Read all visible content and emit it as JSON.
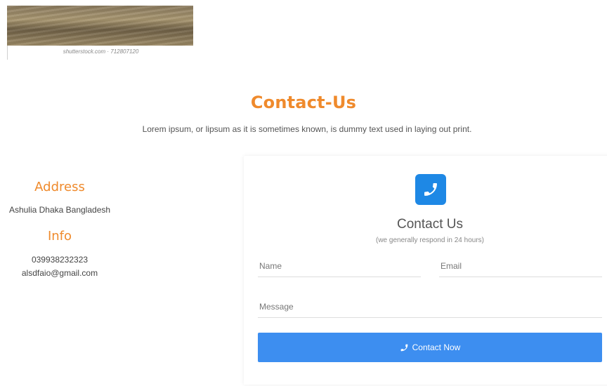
{
  "hero": {
    "caption": "shutterstock.com · 712807120"
  },
  "header": {
    "title": "Contact-Us",
    "subtitle": "Lorem ipsum, or lipsum as it is sometimes known, is dummy text used in laying out print."
  },
  "sidebar": {
    "address_heading": "Address",
    "address_text": "Ashulia Dhaka Bangladesh",
    "info_heading": "Info",
    "phone": "039938232323",
    "email": "alsdfaio@gmail.com"
  },
  "form": {
    "title": "Contact Us",
    "subtitle": "(we generally respond in 24 hours)",
    "name_placeholder": "Name",
    "email_placeholder": "Email",
    "message_placeholder": "Message",
    "submit_label": "Contact Now",
    "icon": "phone-icon"
  },
  "colors": {
    "accent": "#ef8a2c",
    "primary_button": "#3d8ef0",
    "phone_badge": "#1e88e5"
  }
}
